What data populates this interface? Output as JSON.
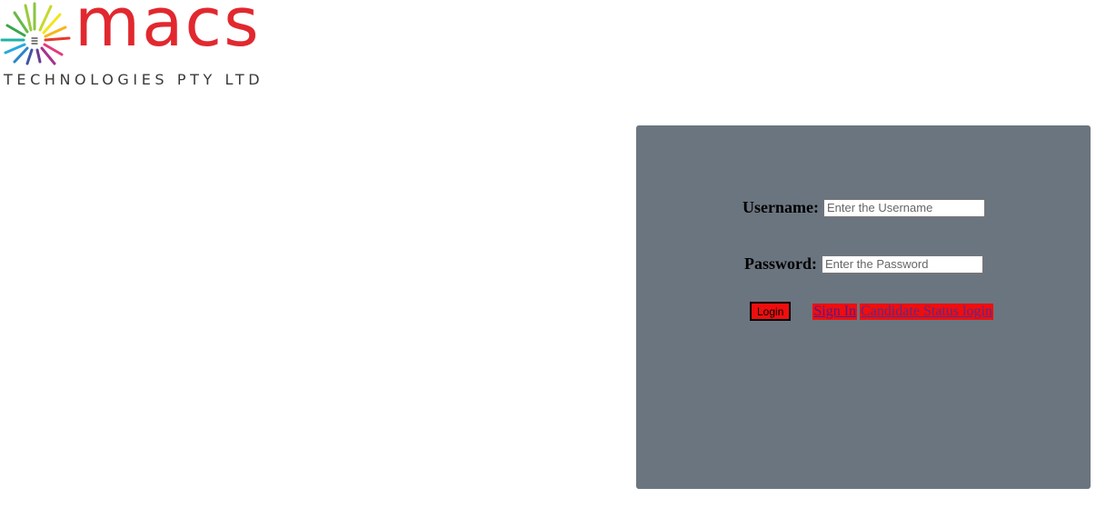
{
  "brand": {
    "name": "macs",
    "subtitle": "TECHNOLOGIES PTY LTD",
    "color": "#e1282f"
  },
  "login": {
    "username_label": "Username:",
    "username_placeholder": "Enter the Username",
    "username_value": "",
    "password_label": "Password:",
    "password_placeholder": "Enter the Password",
    "password_value": "",
    "login_button": "Login",
    "signin_link": "Sign In",
    "candidate_link": "Candidate Status login",
    "panel_color": "#6b7580",
    "button_color": "#ef0e0e"
  }
}
